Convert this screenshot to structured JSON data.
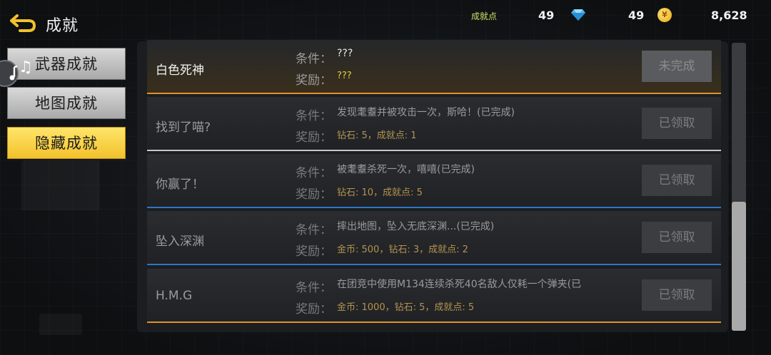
{
  "header": {
    "title": "成就",
    "achievement_points_label": "成就点",
    "achievement_points": "49",
    "gems": "49",
    "coins": "8,628",
    "coin_symbol": "¥"
  },
  "tabs": [
    {
      "label": "武器成就",
      "active": false
    },
    {
      "label": "地图成就",
      "active": false
    },
    {
      "label": "隐藏成就",
      "active": true
    }
  ],
  "labels": {
    "condition": "条件：",
    "reward": "奖励："
  },
  "achievements": [
    {
      "name": "白色死神",
      "condition": "???",
      "reward": "???",
      "button": "未完成",
      "separator_color": "#e0922a"
    },
    {
      "name": "找到了喵?",
      "condition": "发现耄耋并被攻击一次，斯哈！(已完成)",
      "reward": "钻石: 5，成就点: 1",
      "button": "已领取",
      "separator_color": "#c9c9c9"
    },
    {
      "name": "你赢了！",
      "condition": "被耄耋杀死一次，嘻嘻(已完成)",
      "reward": "钻石: 10，成就点: 5",
      "button": "已领取",
      "separator_color": "#2f76c8"
    },
    {
      "name": "坠入深渊",
      "condition": "摔出地图，坠入无底深渊...(已完成)",
      "reward": "金币: 500，钻石: 3，成就点: 2",
      "button": "已领取",
      "separator_color": "#2f76c8"
    },
    {
      "name": "H.M.G",
      "condition": "在团竞中使用M134连续杀死40名敌人仅耗一个弹夹(已",
      "reward": "金币: 1000，钻石: 5，成就点: 5",
      "button": "已领取",
      "separator_color": "#e0922a"
    }
  ],
  "colors": {
    "active_tab": "#f2c12c",
    "reward_text": "#b39350",
    "rare_separator": "#e0922a",
    "common_separator": "#2f76c8"
  }
}
